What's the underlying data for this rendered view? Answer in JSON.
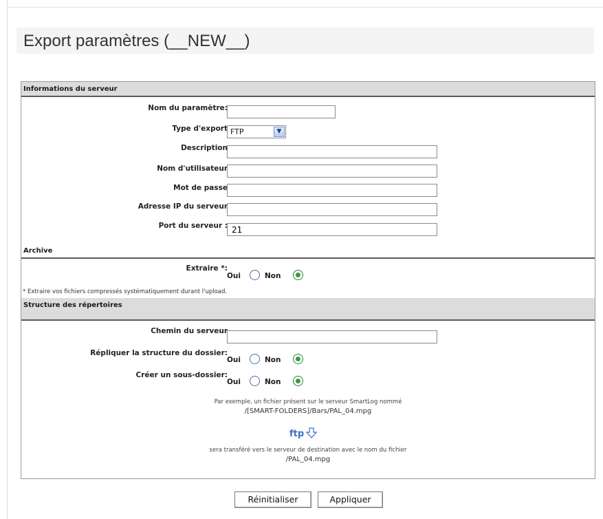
{
  "page": {
    "title": "Export paramètres (__NEW__)"
  },
  "sections": {
    "server_info": {
      "header": "Informations du serveur",
      "fields": [
        {
          "label": "Nom du paramètre:",
          "value": ""
        },
        {
          "label": "Type d'export",
          "value": "FTP"
        },
        {
          "label": "Description",
          "value": ""
        },
        {
          "label": "Nom d'utilisateur",
          "value": ""
        },
        {
          "label": "Mot de passe",
          "value": ""
        },
        {
          "label": "Adresse IP du serveur",
          "value": ""
        },
        {
          "label": "Port du serveur :",
          "value": "21"
        }
      ]
    },
    "archive": {
      "header": "Archive",
      "extract_label": "Extraire *:",
      "oui": "Oui",
      "non": "Non",
      "selected": "Non",
      "note": "* Extraire vos fichiers compressés systématiquement durant l'upload."
    },
    "structure": {
      "header": "Structure des répertoires",
      "server_path_label": "Chemin du serveur",
      "server_path_value": "",
      "replicate_label": "Répliquer la structure du dossier:",
      "replicate_selected": "Non",
      "subfolder_label": "Créer un sous-dossier:",
      "subfolder_selected": "Non",
      "oui": "Oui",
      "non": "Non",
      "example_line1": "Par exemple, un fichier présent sur le serveur SmartLog nommé",
      "example_path1": "/[SMART-FOLDERS]/Bars/PAL_04.mpg",
      "ftp_icon_text": "ftp",
      "example_line2": "sera transféré vers le serveur de destination avec le nom du fichier",
      "example_path2": "/PAL_04.mpg"
    }
  },
  "buttons": {
    "reset": "Réinitialiser",
    "apply": "Appliquer"
  },
  "colors": {
    "radio_checked": "#2e9e3e",
    "section_header_bg": "#dcdcdc",
    "ftp_icon": "#3a6fc4"
  }
}
